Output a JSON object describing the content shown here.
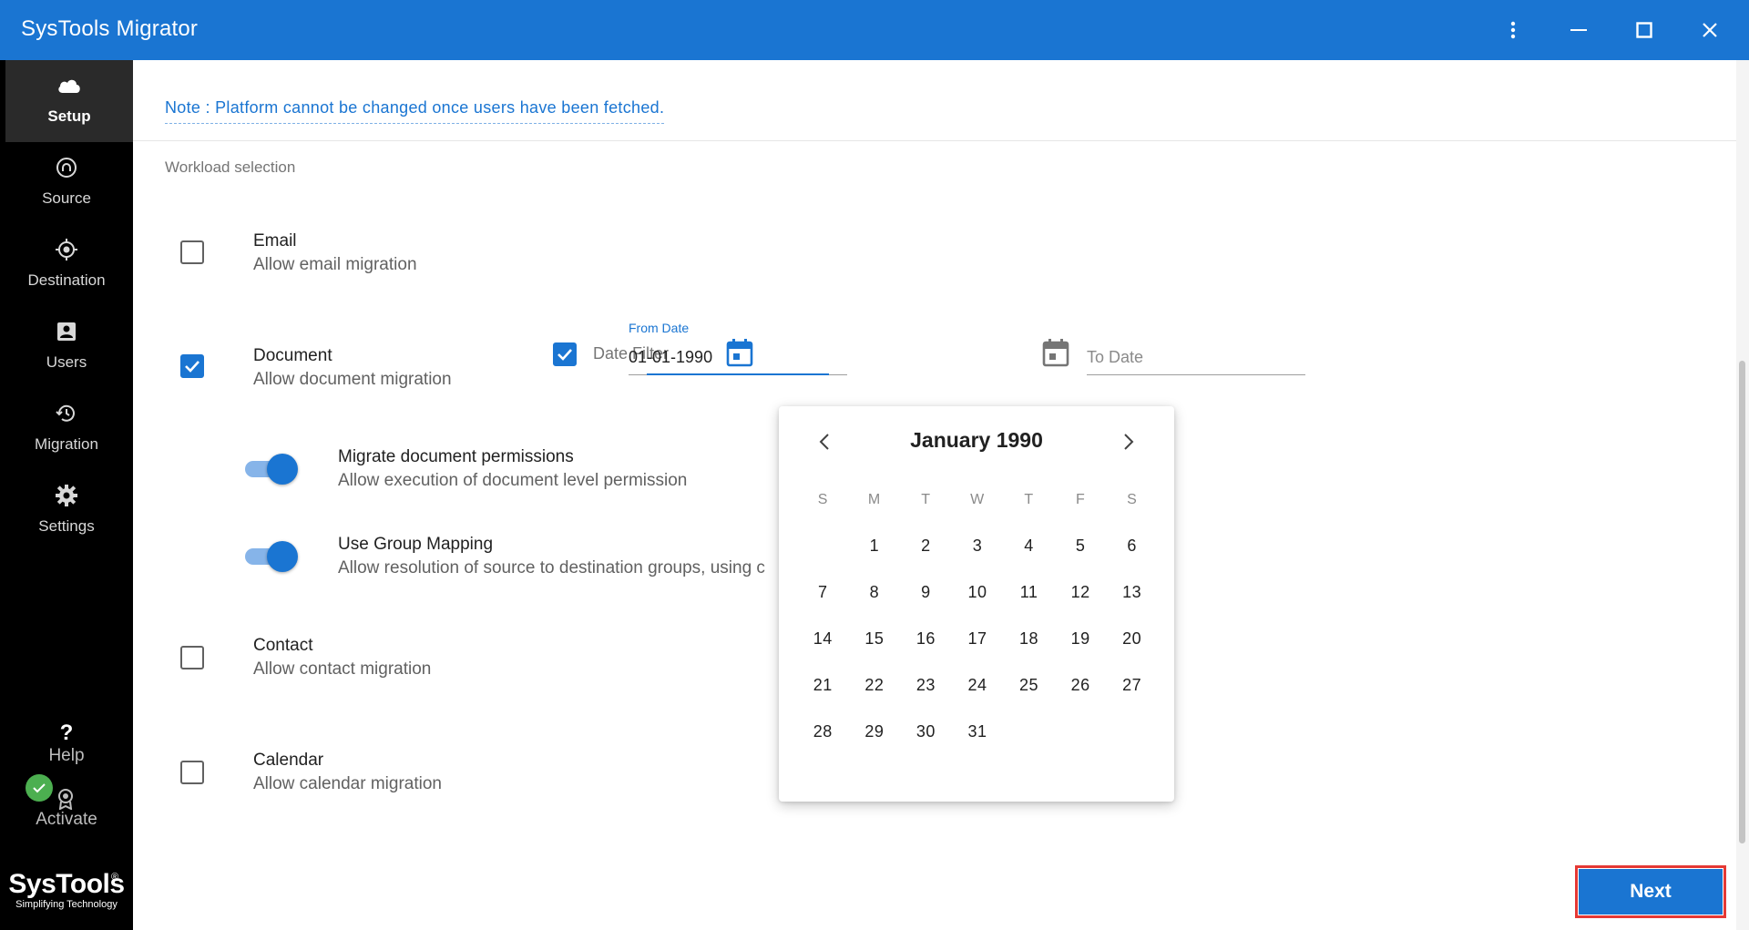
{
  "app": {
    "title": "SysTools Migrator"
  },
  "window_controls": [
    "more-icon",
    "minimize-icon",
    "maximize-icon",
    "close-icon"
  ],
  "sidebar": {
    "items": [
      {
        "label": "Setup",
        "icon": "cloud-icon",
        "active": true
      },
      {
        "label": "Source",
        "icon": "source-icon",
        "active": false
      },
      {
        "label": "Destination",
        "icon": "target-icon",
        "active": false
      },
      {
        "label": "Users",
        "icon": "user-icon",
        "active": false
      },
      {
        "label": "Migration",
        "icon": "history-icon",
        "active": false
      },
      {
        "label": "Settings",
        "icon": "gear-icon",
        "active": false
      }
    ],
    "help": {
      "symbol": "?",
      "label": "Help"
    },
    "activate": {
      "label": "Activate"
    },
    "brand": {
      "name": "SysTools",
      "reg": "®",
      "tagline": "Simplifying Technology"
    }
  },
  "main": {
    "note": "Note : Platform cannot be changed once users have been fetched.",
    "section_label": "Workload selection",
    "workloads": {
      "email": {
        "title": "Email",
        "subtitle": "Allow email migration",
        "checked": false
      },
      "document": {
        "title": "Document",
        "subtitle": "Allow document migration",
        "checked": true
      },
      "contact": {
        "title": "Contact",
        "subtitle": "Allow contact migration",
        "checked": false
      },
      "calendar": {
        "title": "Calendar",
        "subtitle": "Allow calendar migration",
        "checked": false
      }
    },
    "document_options": {
      "permissions": {
        "title": "Migrate document permissions",
        "subtitle": "Allow execution of document level permission",
        "on": true
      },
      "group_mapping": {
        "title": "Use Group Mapping",
        "subtitle": "Allow resolution of source to destination groups, using c",
        "on": true
      }
    },
    "date_filter": {
      "label": "Date Filter",
      "checked": true,
      "from": {
        "label": "From Date",
        "value": "01-01-1990"
      },
      "to": {
        "placeholder": "To Date"
      }
    },
    "datepicker": {
      "month_label": "January 1990",
      "weekdays": [
        "S",
        "M",
        "T",
        "W",
        "T",
        "F",
        "S"
      ],
      "weeks": [
        [
          "",
          "1",
          "2",
          "3",
          "4",
          "5",
          "6"
        ],
        [
          "7",
          "8",
          "9",
          "10",
          "11",
          "12",
          "13"
        ],
        [
          "14",
          "15",
          "16",
          "17",
          "18",
          "19",
          "20"
        ],
        [
          "21",
          "22",
          "23",
          "24",
          "25",
          "26",
          "27"
        ],
        [
          "28",
          "29",
          "30",
          "31",
          "",
          "",
          ""
        ]
      ]
    },
    "next_label": "Next"
  },
  "colors": {
    "primary": "#1a75d2",
    "sidebar": "#000000",
    "highlight": "#e53935",
    "success": "#4caf50"
  }
}
